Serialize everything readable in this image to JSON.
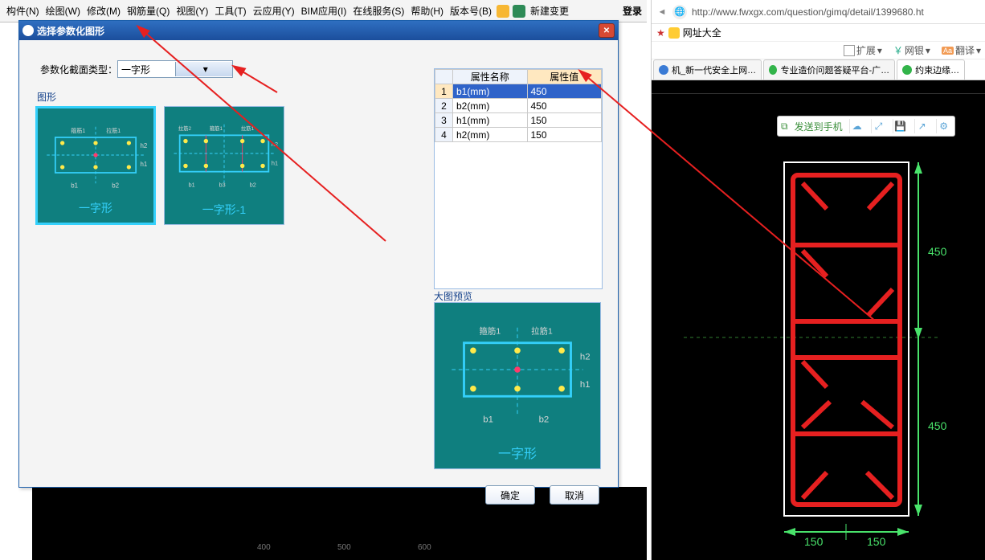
{
  "menu": {
    "items": [
      "构件(N)",
      "绘图(W)",
      "修改(M)",
      "钢筋量(Q)",
      "视图(Y)",
      "工具(T)",
      "云应用(Y)",
      "BIM应用(I)",
      "在线服务(S)",
      "帮助(H)",
      "版本号(B)"
    ],
    "extra_btn": "新建变更",
    "login": "登录"
  },
  "dialog": {
    "title": "选择参数化图形",
    "type_label": "参数化截面类型：",
    "type_value": "一字形",
    "group_shapes": "图形",
    "group_preview": "大图预览",
    "tile1_caption": "一字形",
    "tile2_caption": "一字形-1",
    "diagram": {
      "gj": "箍筋1",
      "lj": "拉筋1",
      "b1": "b1",
      "b2": "b2",
      "h1": "h1",
      "h2": "h2",
      "b3": "b3"
    },
    "ok": "确定",
    "cancel": "取消"
  },
  "props": {
    "col_name": "属性名称",
    "col_value": "属性值",
    "rows": [
      {
        "idx": "1",
        "name": "b1(mm)",
        "value": "450",
        "sel": true
      },
      {
        "idx": "2",
        "name": "b2(mm)",
        "value": "450"
      },
      {
        "idx": "3",
        "name": "h1(mm)",
        "value": "150"
      },
      {
        "idx": "4",
        "name": "h2(mm)",
        "value": "150"
      }
    ]
  },
  "canvas": {
    "tick1": "400",
    "tick2": "500",
    "tick3": "600"
  },
  "browser": {
    "back": "◄",
    "url": "http://www.fwxgx.com/question/gimq/detail/1399680.ht",
    "favorites_label": "网址大全",
    "tools": {
      "ext": "扩展",
      "bank": "网银",
      "trans": "翻译"
    },
    "tabs": [
      {
        "label": "机_新一代安全上网…"
      },
      {
        "label": "专业造价问题答疑平台-广…"
      },
      {
        "label": "约束边缘…",
        "active": true
      }
    ],
    "floatbar": {
      "send": "发送到手机"
    },
    "dims": {
      "d450a": "450",
      "d450b": "450",
      "d150a": "150",
      "d150b": "150"
    }
  }
}
